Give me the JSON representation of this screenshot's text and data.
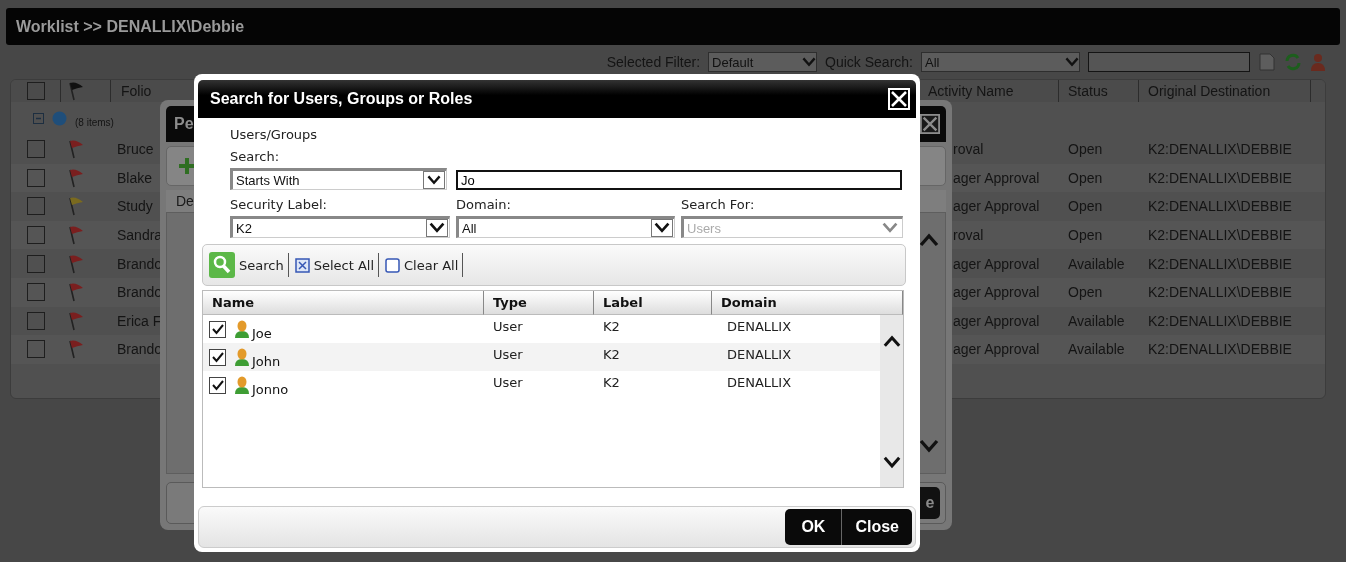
{
  "worklist": {
    "title": "Worklist >> DENALLIX\\Debbie",
    "filter": {
      "label": "Selected Filter:",
      "value": "Default"
    },
    "quick_search": {
      "label": "Quick Search:",
      "value": "All"
    }
  },
  "grid": {
    "all_checked": false,
    "columns": [
      "Folio",
      "Activity Name",
      "Status",
      "Original Destination"
    ],
    "group": {
      "expanded": true,
      "count": "(8 items)"
    },
    "rows": [
      {
        "checked": false,
        "color": "#7a1f1f",
        "folio": "Bruce",
        "activity": "roval",
        "status": "Open",
        "destination": "K2:DENALLIX\\DEBBIE"
      },
      {
        "checked": false,
        "color": "#7a1f1f",
        "folio": "Blake",
        "activity": "ager Approval",
        "status": "Open",
        "destination": "K2:DENALLIX\\DEBBIE"
      },
      {
        "checked": false,
        "color": "#7a6a1f",
        "folio": "Study",
        "activity": "ager Approval",
        "status": "Open",
        "destination": "K2:DENALLIX\\DEBBIE"
      },
      {
        "checked": false,
        "color": "#7a1f1f",
        "folio": "Sandra",
        "activity": "roval",
        "status": "Open",
        "destination": "K2:DENALLIX\\DEBBIE"
      },
      {
        "checked": false,
        "color": "#7a1f1f",
        "folio": "Brando",
        "activity": "ager Approval",
        "status": "Available",
        "destination": "K2:DENALLIX\\DEBBIE"
      },
      {
        "checked": false,
        "color": "#7a1f1f",
        "folio": "Brando",
        "activity": "ager Approval",
        "status": "Open",
        "destination": "K2:DENALLIX\\DEBBIE"
      },
      {
        "checked": false,
        "color": "#7a1f1f",
        "folio": "Erica F",
        "activity": "ager Approval",
        "status": "Available",
        "destination": "K2:DENALLIX\\DEBBIE"
      },
      {
        "checked": false,
        "color": "#7a1f1f",
        "folio": "Brando",
        "activity": "ager Approval",
        "status": "Available",
        "destination": "K2:DENALLIX\\DEBBIE"
      }
    ]
  },
  "back_dialog": {
    "title": "Pe",
    "column": "De",
    "button": "e"
  },
  "dialog": {
    "title": "Search for Users, Groups or Roles",
    "section": "Users/Groups",
    "search_label": "Search:",
    "match": "Starts With",
    "query": "Jo",
    "fields": [
      {
        "label": "Security Label:",
        "value": "K2",
        "disabled": false
      },
      {
        "label": "Domain:",
        "value": "All",
        "disabled": false
      },
      {
        "label": "Search For:",
        "value": "Users",
        "disabled": true
      }
    ],
    "toolbar": [
      {
        "kind": "search",
        "label": "Search"
      },
      {
        "kind": "select_all",
        "label": "Select All"
      },
      {
        "kind": "clear_all",
        "label": "Clear All"
      }
    ],
    "columns": [
      "Name",
      "Type",
      "Label",
      "Domain"
    ],
    "rows": [
      {
        "checked": true,
        "name": "Joe",
        "type": "User",
        "label": "K2",
        "domain": "DENALLIX"
      },
      {
        "checked": true,
        "name": "John",
        "type": "User",
        "label": "K2",
        "domain": "DENALLIX"
      },
      {
        "checked": true,
        "name": "Jonno",
        "type": "User",
        "label": "K2",
        "domain": "DENALLIX"
      }
    ],
    "buttons": [
      "OK",
      "Close"
    ]
  }
}
